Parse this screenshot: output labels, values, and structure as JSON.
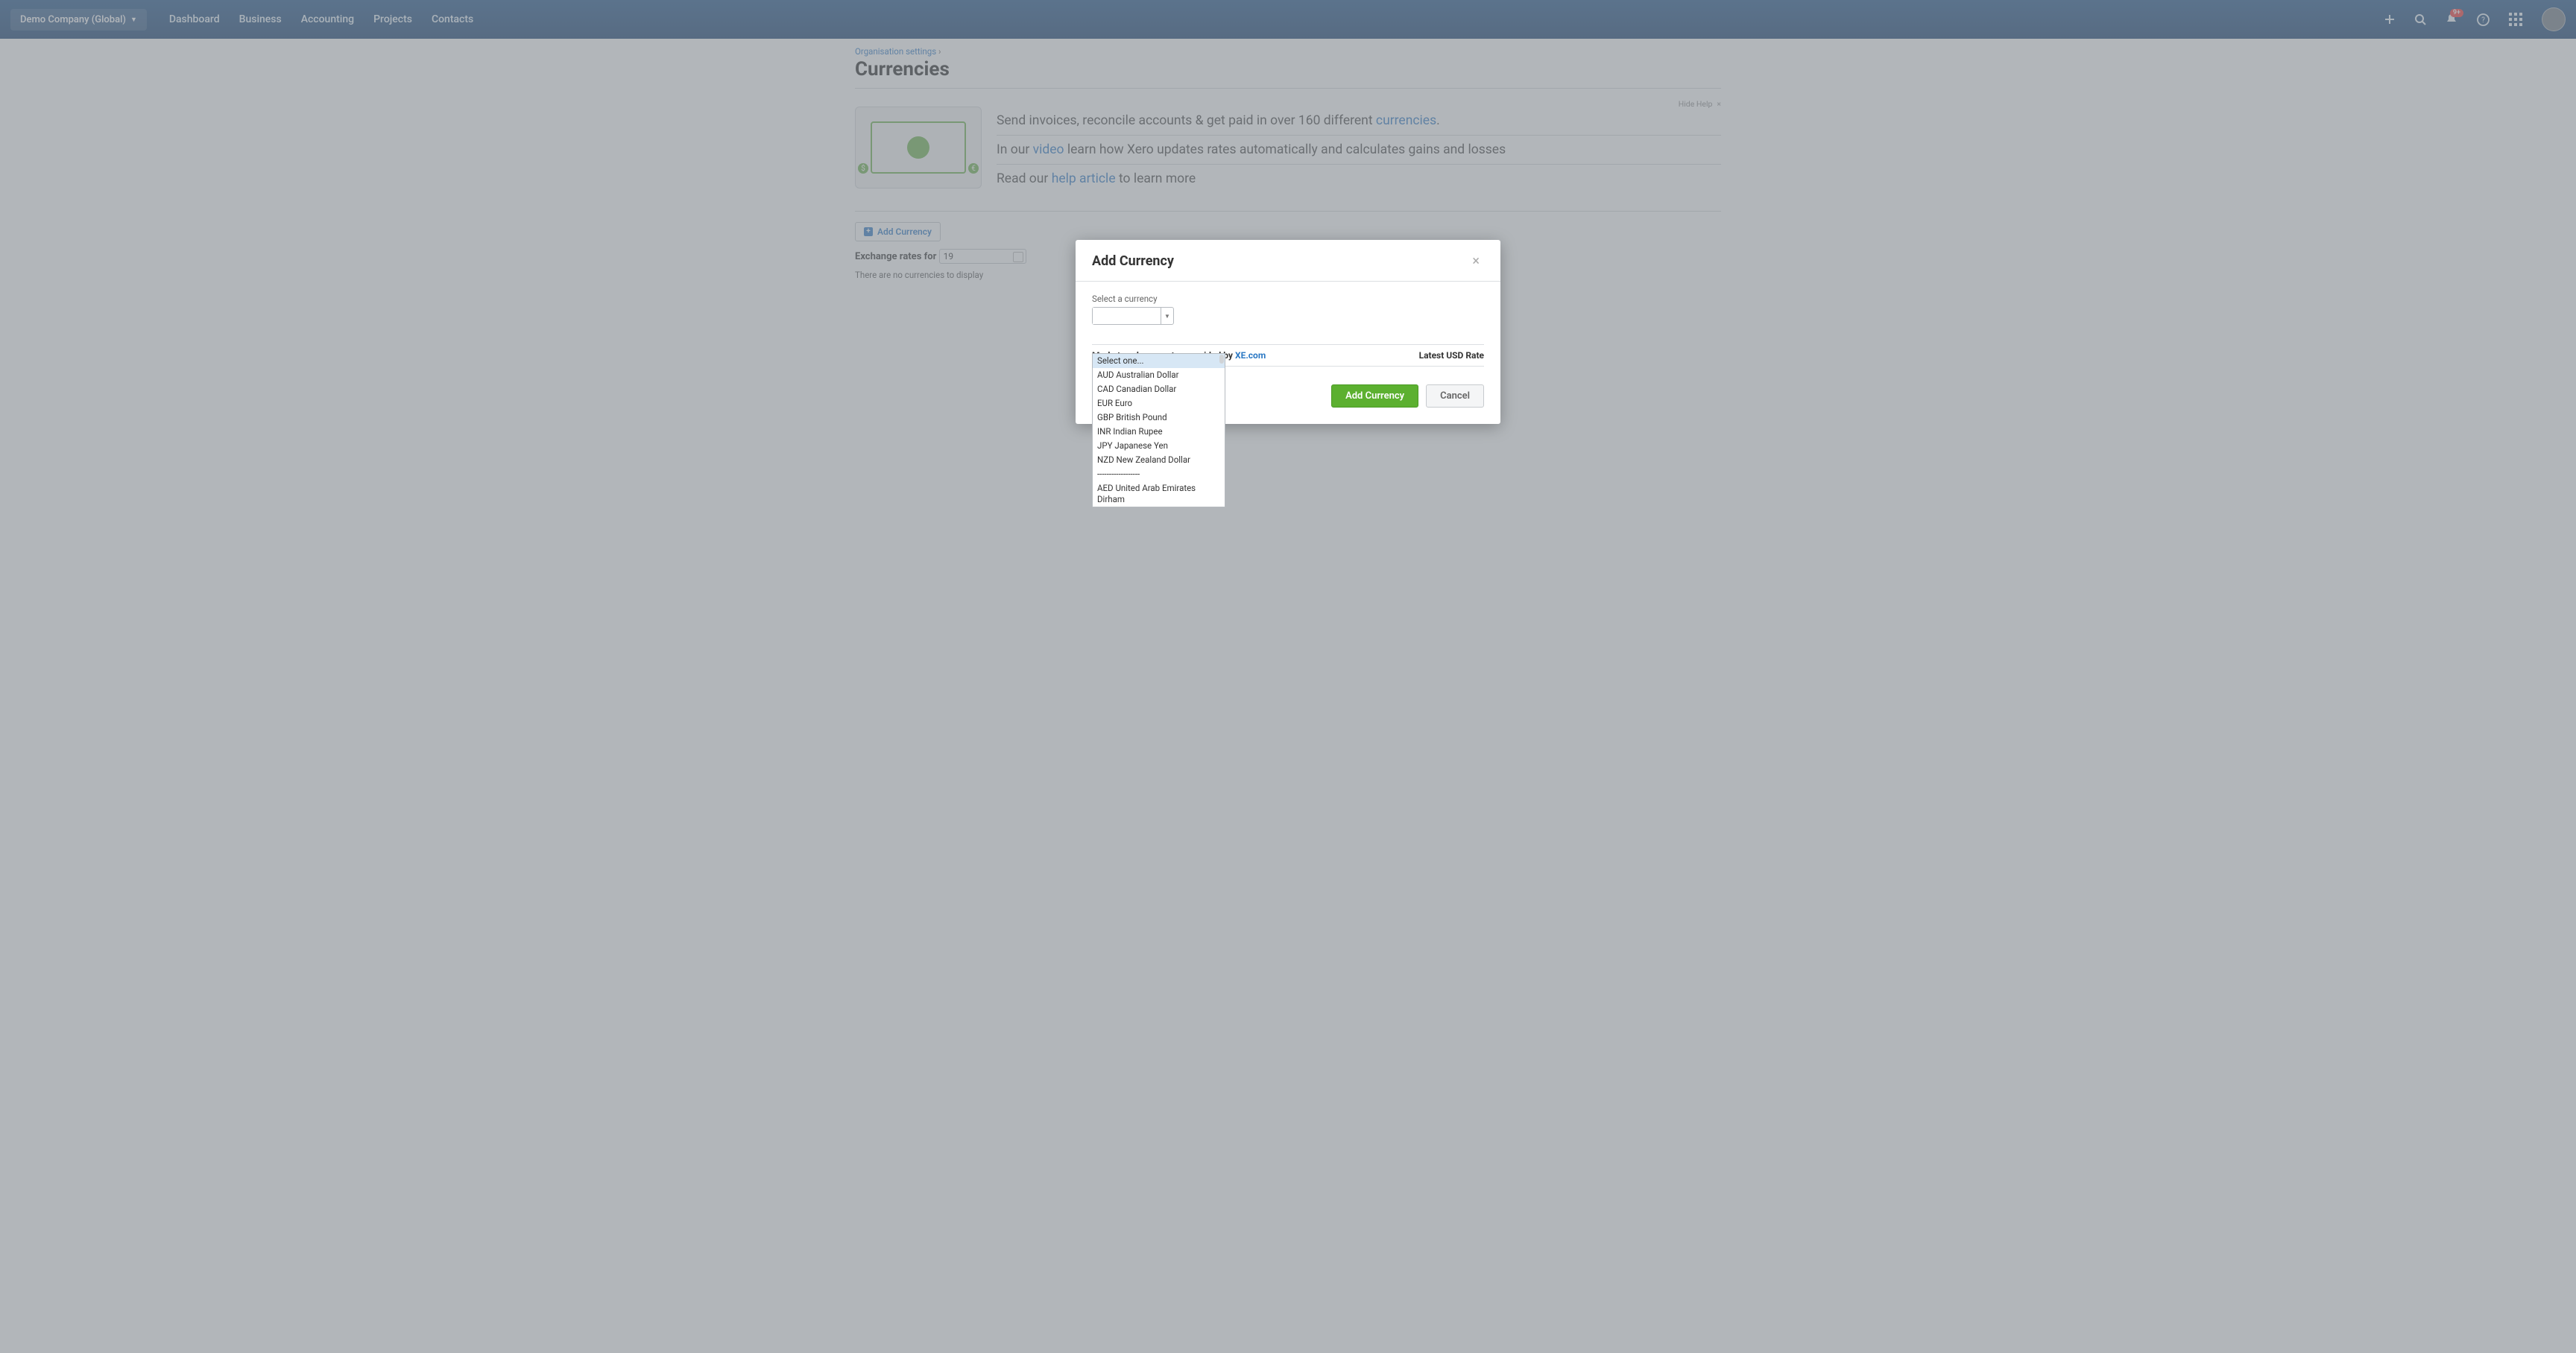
{
  "topbar": {
    "org_name": "Demo Company (Global)",
    "nav": [
      "Dashboard",
      "Business",
      "Accounting",
      "Projects",
      "Contacts"
    ],
    "notification_badge": "9+"
  },
  "breadcrumb": {
    "org_settings": "Organisation settings",
    "sep": "›"
  },
  "page_title": "Currencies",
  "help": {
    "hide": "Hide Help",
    "line1_prefix": "Send invoices, reconcile accounts & get paid in over 160 different ",
    "line1_link": "currencies",
    "line1_suffix": ".",
    "line2_prefix": "In our ",
    "line2_link": "video",
    "line2_suffix": " learn how Xero updates rates automatically and calculates gains and losses",
    "line3_prefix": "Read our ",
    "line3_link": "help article",
    "line3_suffix": " to learn more"
  },
  "add_currency_btn": "Add Currency",
  "rates_label": "Exchange rates for",
  "rates_date": "19",
  "empty_msg": "There are no currencies to display",
  "modal": {
    "title": "Add Currency",
    "select_label": "Select a currency",
    "rate_col_left_prefix": "Market exchange rates provided by ",
    "rate_col_left_link": "XE.com",
    "rate_col_right": "Latest USD Rate",
    "add_btn": "Add Currency",
    "cancel_btn": "Cancel"
  },
  "dropdown": {
    "options": [
      "Select one...",
      "AUD Australian Dollar",
      "CAD Canadian Dollar",
      "EUR Euro",
      "GBP British Pound",
      "INR Indian Rupee",
      "JPY Japanese Yen",
      "NZD New Zealand Dollar",
      "------------------",
      "AED United Arab Emirates Dirham"
    ]
  }
}
